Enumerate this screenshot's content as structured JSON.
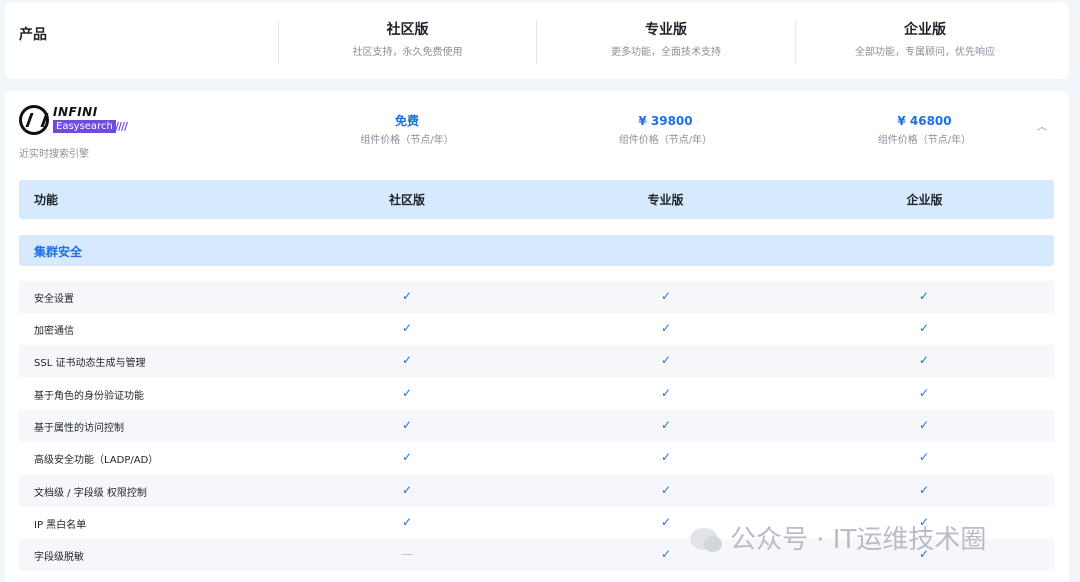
{
  "top": {
    "product_label": "产品",
    "editions": [
      {
        "name": "社区版",
        "desc": "社区支持，永久免费使用"
      },
      {
        "name": "专业版",
        "desc": "更多功能，全面技术支持"
      },
      {
        "name": "企业版",
        "desc": "全部功能，专属顾问，优先响应"
      }
    ]
  },
  "product": {
    "logo_top": "INFINI",
    "logo_bottom": "Easysearch",
    "logo_stripes": "////",
    "tagline": "近实时搜索引擎",
    "prices": [
      {
        "price": "免费",
        "unit": "组件价格（节点/年）"
      },
      {
        "price": "¥ 39800",
        "unit": "组件价格（节点/年）"
      },
      {
        "price": "¥ 46800",
        "unit": "组件价格（节点/年）"
      }
    ],
    "collapse_glyph": "︿"
  },
  "table": {
    "headers": [
      "功能",
      "社区版",
      "专业版",
      "企业版"
    ],
    "section": "集群安全",
    "check_glyph": "✓",
    "dash_glyph": "—",
    "rows": [
      {
        "label": "安全设置",
        "values": [
          "check",
          "check",
          "check"
        ]
      },
      {
        "label": "加密通信",
        "values": [
          "check",
          "check",
          "check"
        ]
      },
      {
        "label": "SSL 证书动态生成与管理",
        "values": [
          "check",
          "check",
          "check"
        ]
      },
      {
        "label": "基于角色的身份验证功能",
        "values": [
          "check",
          "check",
          "check"
        ]
      },
      {
        "label": "基于属性的访问控制",
        "values": [
          "check",
          "check",
          "check"
        ]
      },
      {
        "label": "高级安全功能（LADP/AD）",
        "values": [
          "check",
          "check",
          "check"
        ]
      },
      {
        "label": "文档级 / 字段级 权限控制",
        "values": [
          "check",
          "check",
          "check"
        ]
      },
      {
        "label": "IP 黑白名单",
        "values": [
          "check",
          "check",
          "check"
        ]
      },
      {
        "label": "字段级脱敏",
        "values": [
          "dash",
          "check",
          "check"
        ]
      }
    ]
  },
  "watermark": {
    "text": "公众号 · IT运维技术圈"
  },
  "colors": {
    "accent": "#1d6fe5",
    "header_bg": "#d7e9fd",
    "page_bg": "#f2f5fa"
  }
}
